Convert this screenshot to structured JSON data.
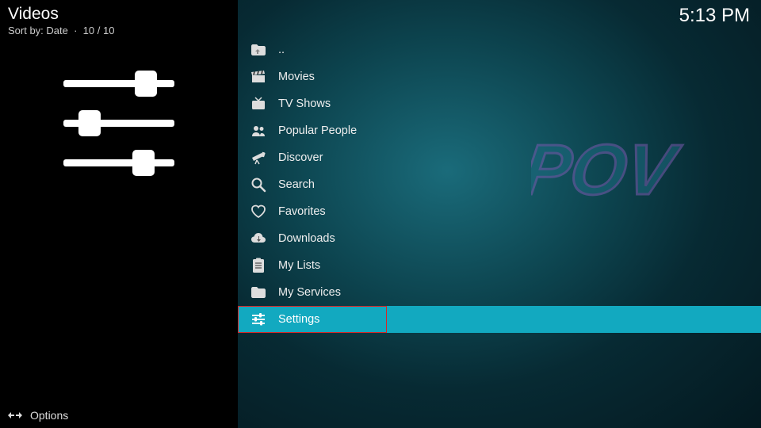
{
  "header": {
    "title": "Videos",
    "sort_label": "Sort by: Date",
    "count": "10 / 10"
  },
  "clock": "5:13 PM",
  "menu": {
    "items": [
      {
        "id": "up",
        "label": ".."
      },
      {
        "id": "movies",
        "label": "Movies"
      },
      {
        "id": "tvshows",
        "label": "TV Shows"
      },
      {
        "id": "people",
        "label": "Popular People"
      },
      {
        "id": "discover",
        "label": "Discover"
      },
      {
        "id": "search",
        "label": "Search"
      },
      {
        "id": "favorites",
        "label": "Favorites"
      },
      {
        "id": "downloads",
        "label": "Downloads"
      },
      {
        "id": "mylists",
        "label": "My Lists"
      },
      {
        "id": "myservices",
        "label": "My Services"
      },
      {
        "id": "settings",
        "label": "Settings"
      }
    ],
    "selected_index": 10
  },
  "footer": {
    "options_label": "Options"
  },
  "watermark": "POV",
  "colors": {
    "selected_bg": "#12a9c0",
    "highlight_border": "#d62828"
  }
}
